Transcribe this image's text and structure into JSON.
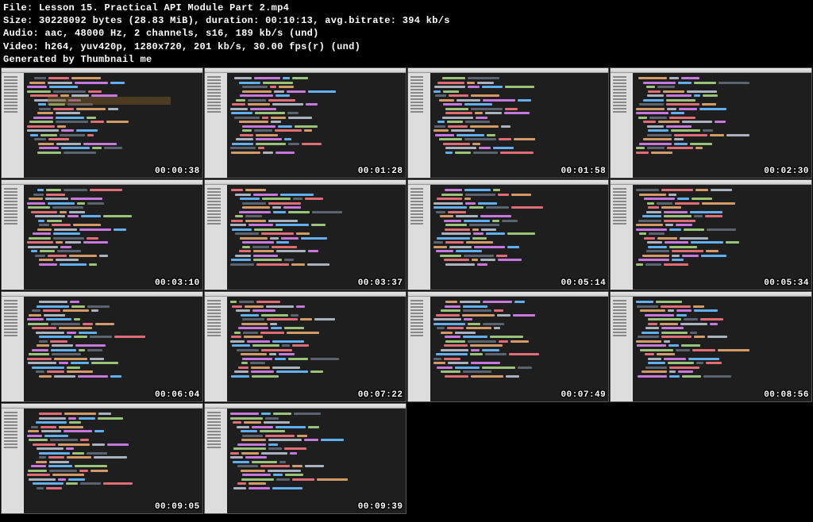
{
  "header": {
    "file_label": "File:",
    "file_value": "Lesson 15. Practical API Module Part 2.mp4",
    "size_label": "Size:",
    "size_bytes": "30228092",
    "size_unit": "bytes",
    "size_mib": "(28.83 MiB),",
    "duration_label": "duration:",
    "duration_value": "00:10:13,",
    "bitrate_label": "avg.bitrate:",
    "bitrate_value": "394 kb/s",
    "audio_label": "Audio:",
    "audio_value": "aac, 48000 Hz, 2 channels, s16, 189 kb/s (und)",
    "video_label": "Video:",
    "video_value": "h264, yuv420p, 1280x720, 201 kb/s, 30.00 fps(r) (und)",
    "generated": "Generated by Thumbnail me"
  },
  "thumbnails": [
    {
      "timestamp": "00:00:38",
      "has_highlight": true
    },
    {
      "timestamp": "00:01:28",
      "has_highlight": false
    },
    {
      "timestamp": "00:01:58",
      "has_highlight": false
    },
    {
      "timestamp": "00:02:30",
      "has_highlight": false
    },
    {
      "timestamp": "00:03:10",
      "has_highlight": false
    },
    {
      "timestamp": "00:03:37",
      "has_highlight": false
    },
    {
      "timestamp": "00:05:14",
      "has_highlight": false
    },
    {
      "timestamp": "00:05:34",
      "has_highlight": false
    },
    {
      "timestamp": "00:06:04",
      "has_highlight": false
    },
    {
      "timestamp": "00:07:22",
      "has_highlight": false
    },
    {
      "timestamp": "00:07:49",
      "has_highlight": false
    },
    {
      "timestamp": "00:08:56",
      "has_highlight": false
    },
    {
      "timestamp": "00:09:05",
      "has_highlight": false
    },
    {
      "timestamp": "00:09:39",
      "has_highlight": false
    }
  ]
}
